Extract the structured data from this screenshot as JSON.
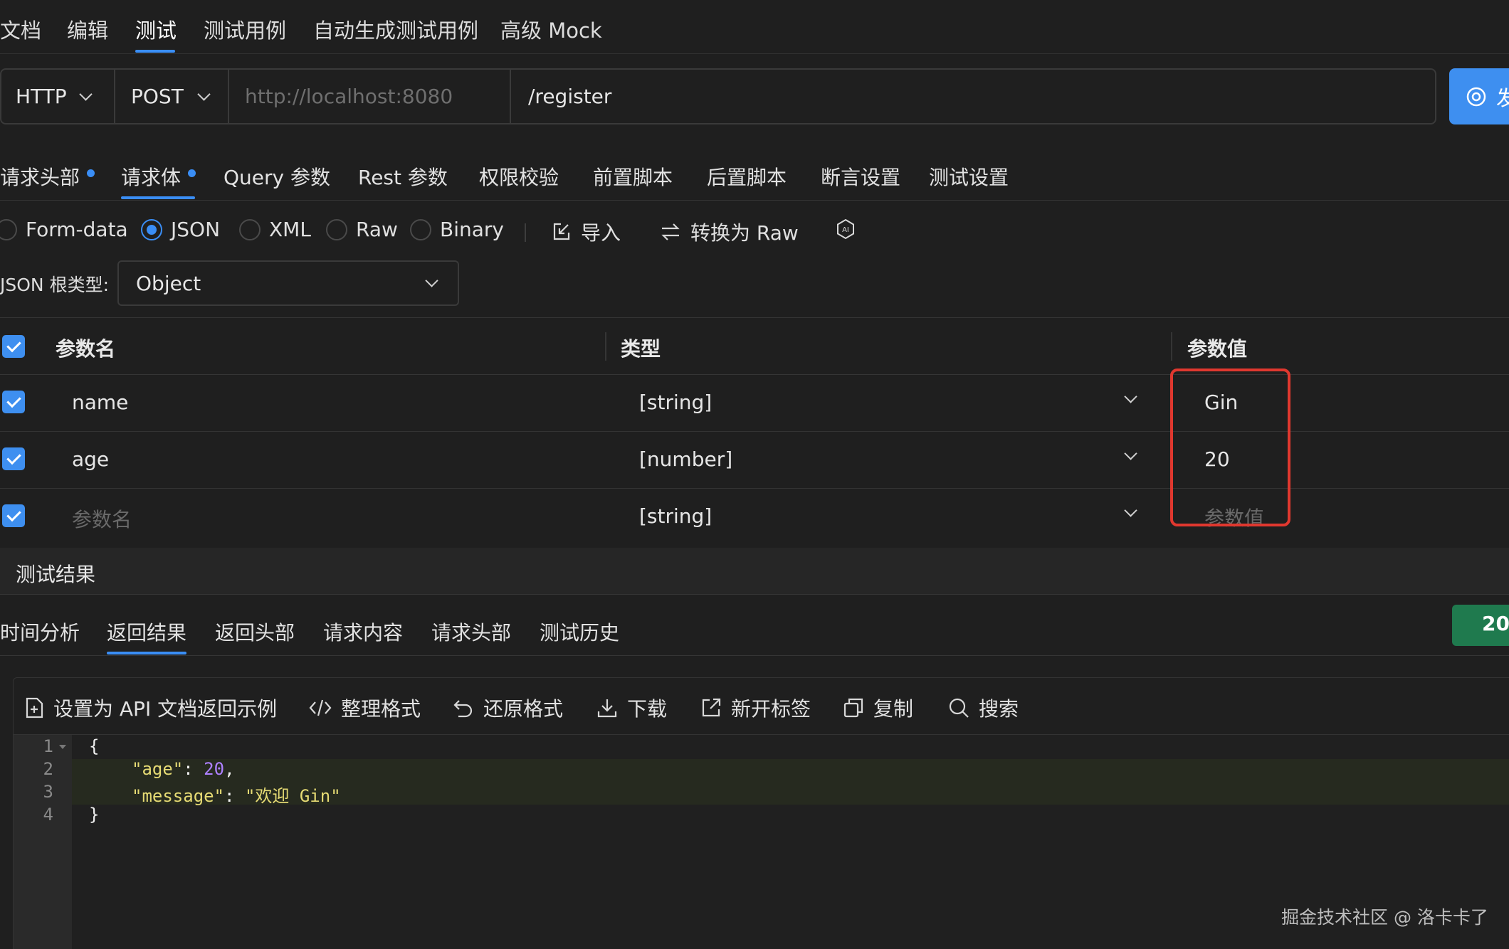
{
  "top_tabs": [
    "文档",
    "编辑",
    "测试",
    "测试用例",
    "自动生成测试用例",
    "高级 Mock"
  ],
  "request": {
    "protocol": "HTTP",
    "method": "POST",
    "base_url_placeholder": "http://localhost:8080",
    "path": "/register",
    "send_label": "发"
  },
  "body_tabs": [
    "请求头部",
    "请求体",
    "Query 参数",
    "Rest 参数",
    "权限校验",
    "前置脚本",
    "后置脚本",
    "断言设置",
    "测试设置"
  ],
  "body_types": [
    "Form-data",
    "JSON",
    "XML",
    "Raw",
    "Binary"
  ],
  "body_selected": "JSON",
  "body_tools": {
    "import": "导入",
    "to_raw": "转换为 Raw"
  },
  "json_root": {
    "label": "JSON 根类型:",
    "value": "Object"
  },
  "table": {
    "headers": {
      "name": "参数名",
      "type": "类型",
      "value": "参数值"
    },
    "rows": [
      {
        "name": "name",
        "type": "[string]",
        "value": "Gin",
        "checked": true
      },
      {
        "name": "age",
        "type": "[number]",
        "value": "20",
        "checked": true
      },
      {
        "name": "参数名",
        "type": "[string]",
        "value": "参数值",
        "checked": true,
        "placeholder": true
      }
    ]
  },
  "result": {
    "title": "测试结果",
    "tabs": [
      "时间分析",
      "返回结果",
      "返回头部",
      "请求内容",
      "请求头部",
      "测试历史"
    ],
    "status": "20",
    "toolbar": [
      "设置为 API 文档返回示例",
      "整理格式",
      "还原格式",
      "下载",
      "新开标签",
      "复制",
      "搜索"
    ],
    "line_numbers": [
      "1",
      "2",
      "3",
      "4"
    ],
    "code": {
      "open": "{",
      "age_key": "\"age\"",
      "age_val": "20",
      "msg_key": "\"message\"",
      "msg_val": "\"欢迎 Gin\"",
      "close": "}"
    }
  },
  "watermark": "掘金技术社区 @ 洛卡卡了",
  "colors": {
    "accent": "#3e8ff0",
    "status_green": "#1f7a4e",
    "highlight_red": "#e0382f"
  }
}
